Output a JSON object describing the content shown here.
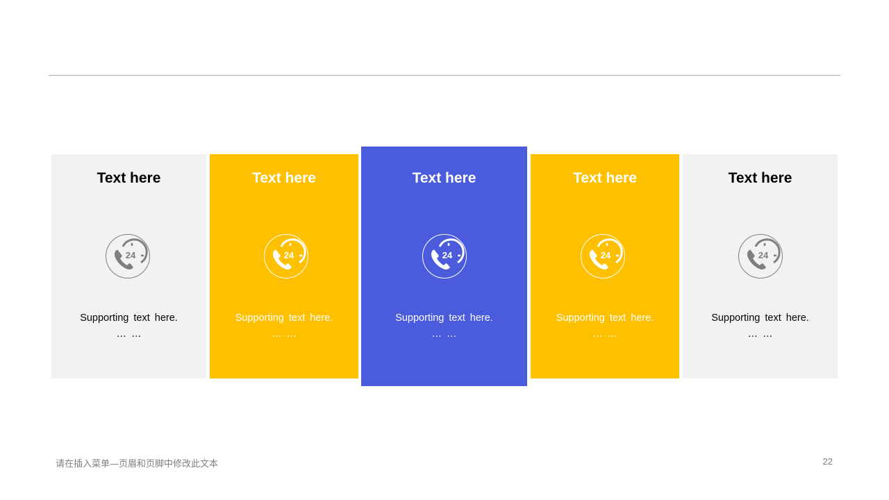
{
  "slide": {
    "footer_text": "请在插入菜单—页眉和页脚中修改此文本",
    "page_number": "22"
  },
  "colors": {
    "light_gray": "#f2f2f2",
    "yellow": "#ffc000",
    "blue": "#4a5bdc",
    "dark_text": "#000000",
    "light_text": "#ffffff",
    "icon_gray": "#7f7f7f",
    "rule_gray": "#a6a6a6"
  },
  "cards": [
    {
      "title": "Text here",
      "icon": "phone-24-hours-icon",
      "text_line1": "Supporting text here.",
      "text_line2": "… …",
      "fill": "#f2f2f2"
    },
    {
      "title": "Text here",
      "icon": "phone-24-hours-icon",
      "text_line1": "Supporting text here.",
      "text_line2": "… …",
      "fill": "#ffc000"
    },
    {
      "title": "Text here",
      "icon": "phone-24-hours-icon",
      "text_line1": "Supporting text here.",
      "text_line2": "… …",
      "fill": "#4a5bdc"
    },
    {
      "title": "Text here",
      "icon": "phone-24-hours-icon",
      "text_line1": "Supporting text here.",
      "text_line2": "… …",
      "fill": "#ffc000"
    },
    {
      "title": "Text here",
      "icon": "phone-24-hours-icon",
      "text_line1": "Supporting text here.",
      "text_line2": "… …",
      "fill": "#f2f2f2"
    }
  ]
}
